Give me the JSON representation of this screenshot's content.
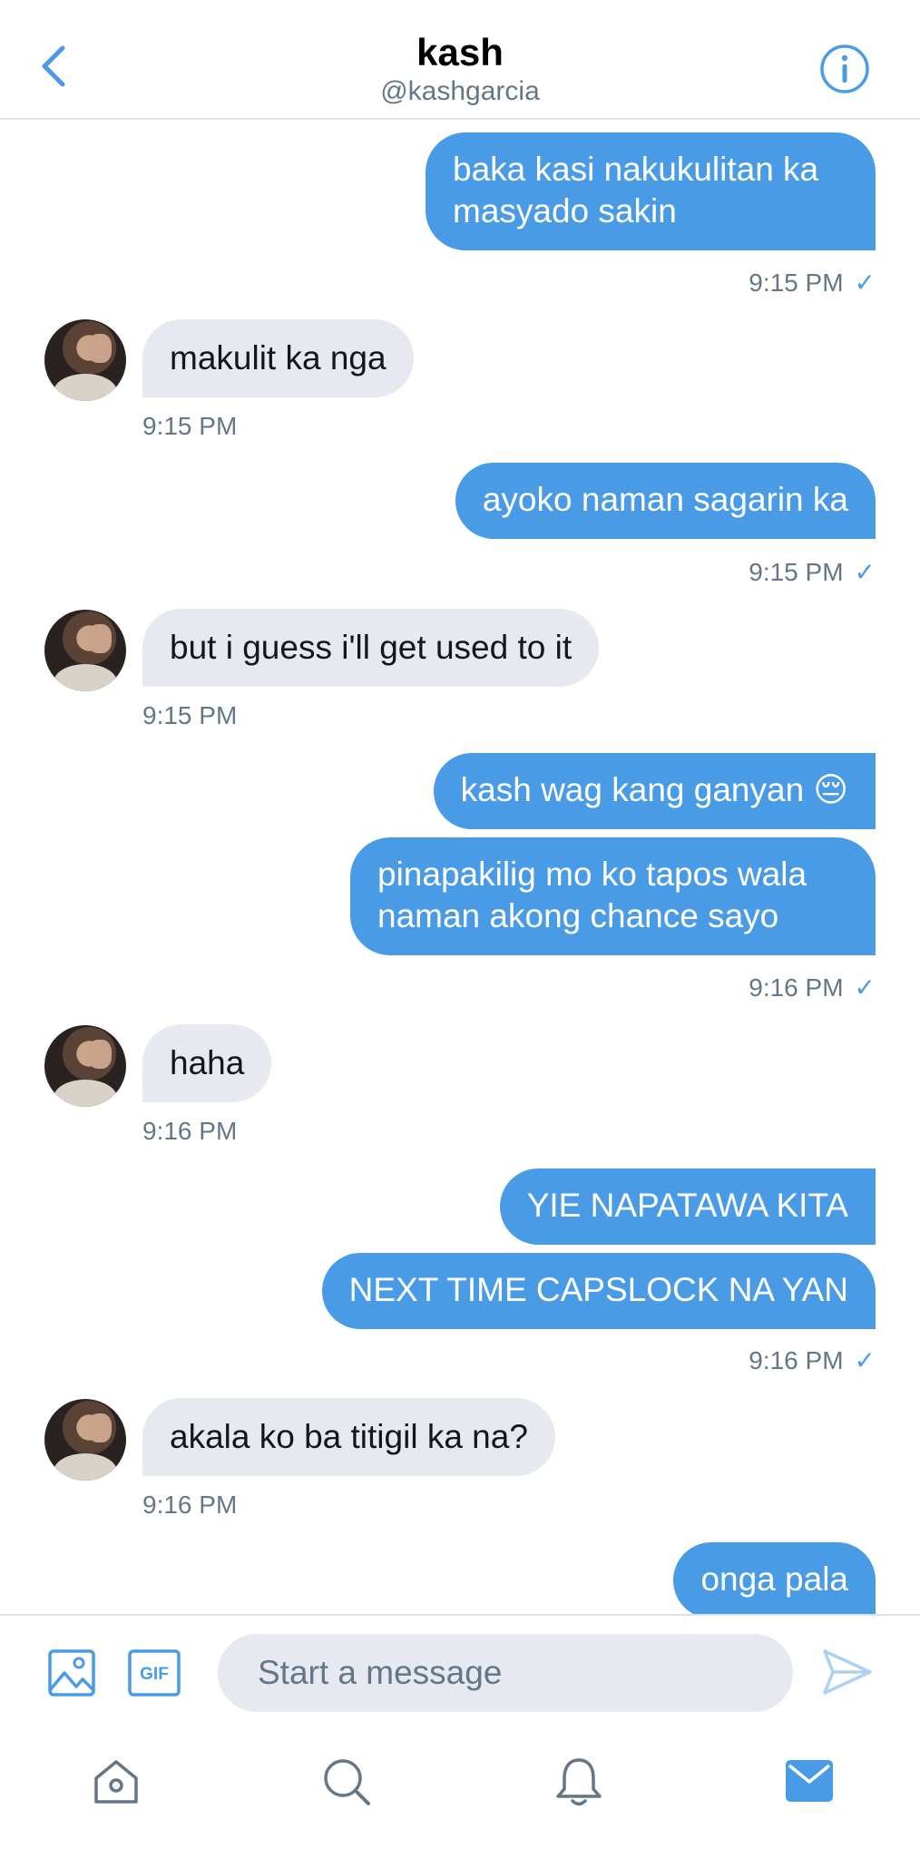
{
  "header": {
    "title": "kash",
    "handle": "@kashgarcia",
    "back_icon": "chevron-left-icon",
    "info_icon": "info-icon"
  },
  "messages": [
    {
      "from": "me",
      "text": "baka kasi nakukulitan ka masyado sakin"
    },
    {
      "from": "me",
      "time": "9:15 PM"
    },
    {
      "from": "kash",
      "text": "makulit ka nga",
      "time": "9:15 PM"
    },
    {
      "from": "me",
      "text": "ayoko naman sagarin ka",
      "time": "9:15 PM"
    },
    {
      "from": "kash",
      "text": "but i guess i'll get used to it",
      "time": "9:15 PM"
    },
    {
      "from": "me",
      "text": "kash wag kang ganyan 😔"
    },
    {
      "from": "me",
      "text": "pinapakilig mo ko tapos wala naman akong chance sayo",
      "time": "9:16 PM"
    },
    {
      "from": "kash",
      "text": "haha",
      "time": "9:16 PM"
    },
    {
      "from": "me",
      "text": "YIE NAPATAWA KITA"
    },
    {
      "from": "me",
      "text": "NEXT TIME CAPSLOCK NA YAN",
      "time": "9:16 PM"
    },
    {
      "from": "kash",
      "text": "akala ko ba titigil ka na?",
      "time": "9:16 PM"
    },
    {
      "from": "me",
      "text": "onga pala"
    }
  ],
  "read_receipt": "✓",
  "composer": {
    "placeholder": "Start a message",
    "gif_label": "GIF",
    "icons": [
      "image-icon",
      "gif-icon",
      "send-icon"
    ]
  },
  "tabbar": {
    "icons": [
      "home-icon",
      "search-icon",
      "notifications-icon",
      "messages-icon"
    ]
  },
  "colors": {
    "accent": "#4a9be6",
    "incoming_bubble": "#e6e9ef",
    "secondary_text": "#657786"
  }
}
